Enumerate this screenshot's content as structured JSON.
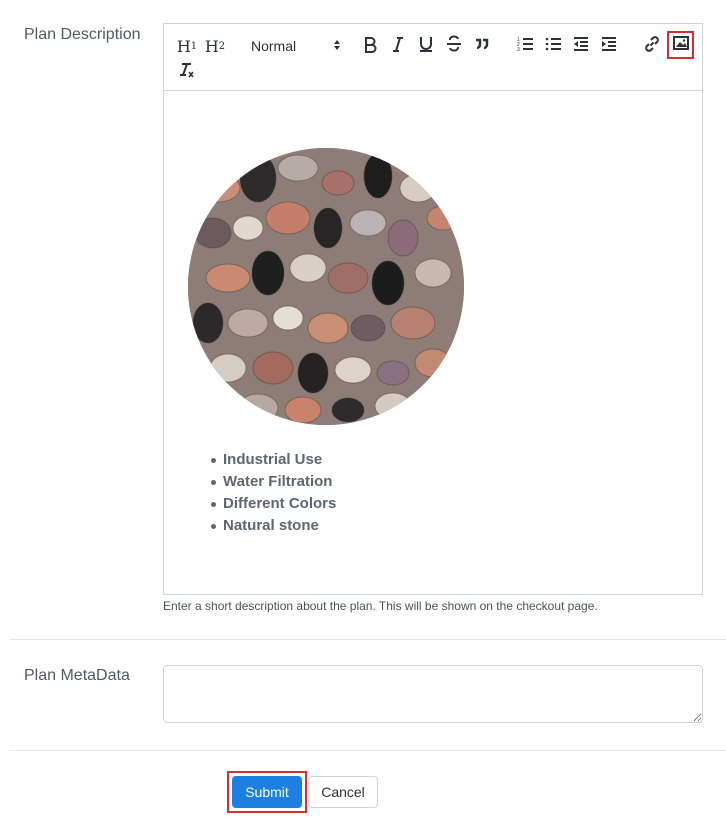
{
  "form": {
    "description_label": "Plan Description",
    "metadata_label": "Plan MetaData",
    "helper_text": "Enter a short description about the plan. This will be shown on the checkout page.",
    "metadata_value": ""
  },
  "toolbar": {
    "h1": "H",
    "h1_sub": "1",
    "h2": "H",
    "h2_sub": "2",
    "format_value": "Normal",
    "icons": [
      "bold-icon",
      "italic-icon",
      "underline-icon",
      "strike-icon",
      "blockquote-icon",
      "ordered-list-icon",
      "bullet-list-icon",
      "outdent-icon",
      "indent-icon",
      "link-icon",
      "image-icon",
      "clear-format-icon"
    ]
  },
  "content": {
    "image": "pebble-stones-image",
    "bullets": [
      "Industrial Use",
      "Water Filtration",
      "Different Colors",
      "Natural stone"
    ]
  },
  "actions": {
    "submit_label": "Submit",
    "cancel_label": "Cancel"
  },
  "colors": {
    "primary": "#1d7fe0",
    "highlight": "#d32f2f"
  }
}
